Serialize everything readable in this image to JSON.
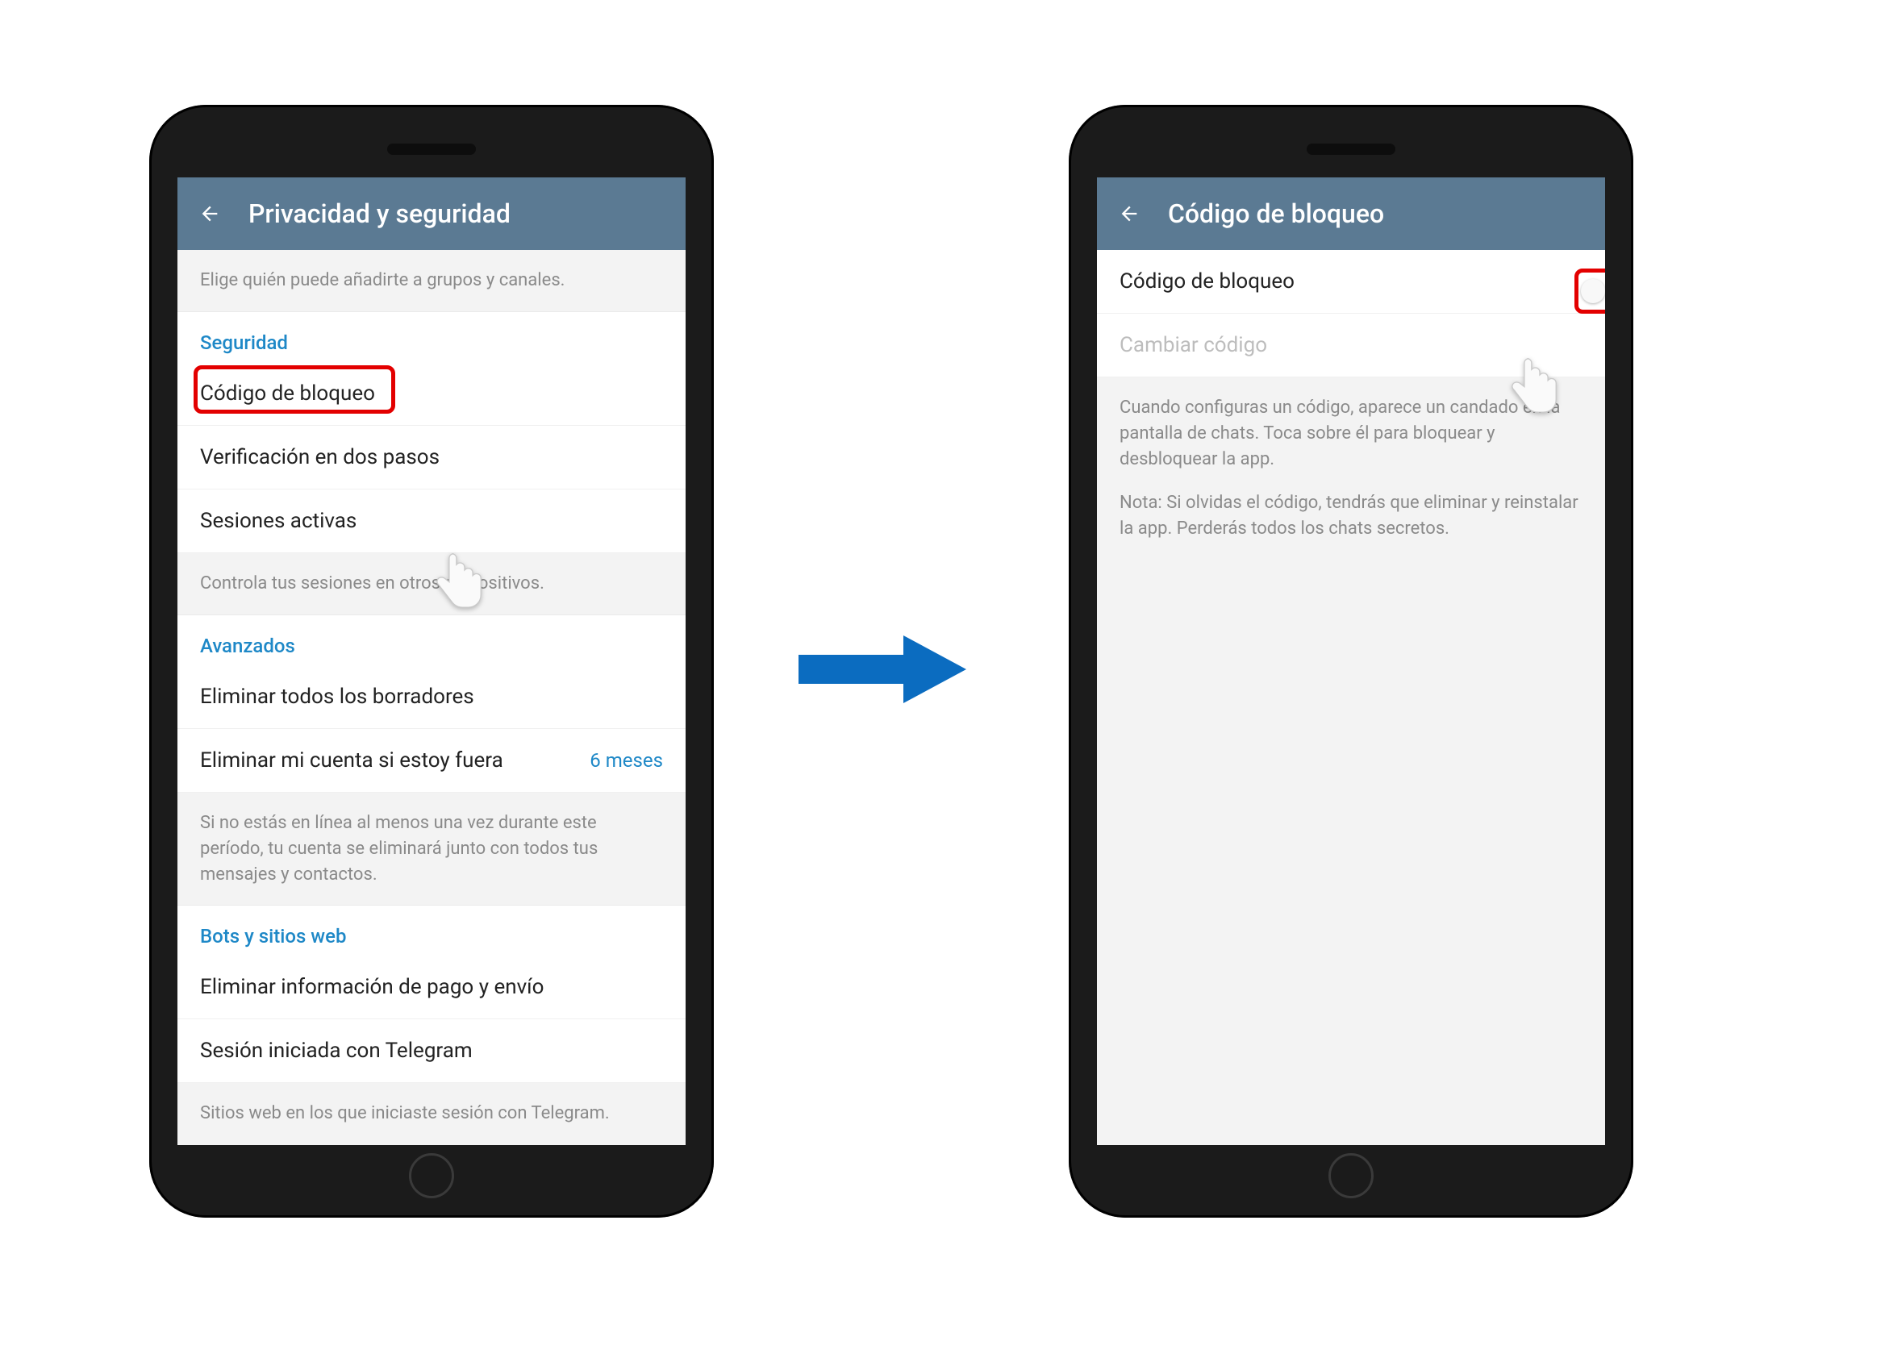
{
  "colors": {
    "appbar": "#5b7a93",
    "accent": "#1e88c7",
    "highlight": "#e30000",
    "arrow": "#0b6cc0"
  },
  "left": {
    "title": "Privacidad y seguridad",
    "intro": "Elige quién puede añadirte a grupos y canales.",
    "section_security": "Seguridad",
    "row_passcode": "Código de bloqueo",
    "row_twostep": "Verificación en dos pasos",
    "row_sessions": "Sesiones activas",
    "info_sessions": "Controla tus sesiones en otros dispositivos.",
    "section_advanced": "Avanzados",
    "row_delete_drafts": "Eliminar todos los borradores",
    "row_delete_account": "Eliminar mi cuenta si estoy fuera",
    "row_delete_account_value": "6 meses",
    "info_delete": "Si no estás en línea al menos una vez durante este período, tu cuenta se eliminará junto con todos tus mensajes y contactos.",
    "section_bots": "Bots y sitios web",
    "row_payment": "Eliminar información de pago y envío",
    "row_session_telegram": "Sesión iniciada con Telegram",
    "info_bots": "Sitios web en los que iniciaste sesión con Telegram."
  },
  "right": {
    "title": "Código de bloqueo",
    "row_toggle": "Código de bloqueo",
    "row_change": "Cambiar código",
    "info1": "Cuando configuras un código, aparece un candado en la pantalla de chats. Toca sobre él para bloquear y desbloquear la app.",
    "info2": "Nota: Si olvidas el código, tendrás que eliminar y reinstalar la app. Perderás todos los chats secretos."
  }
}
